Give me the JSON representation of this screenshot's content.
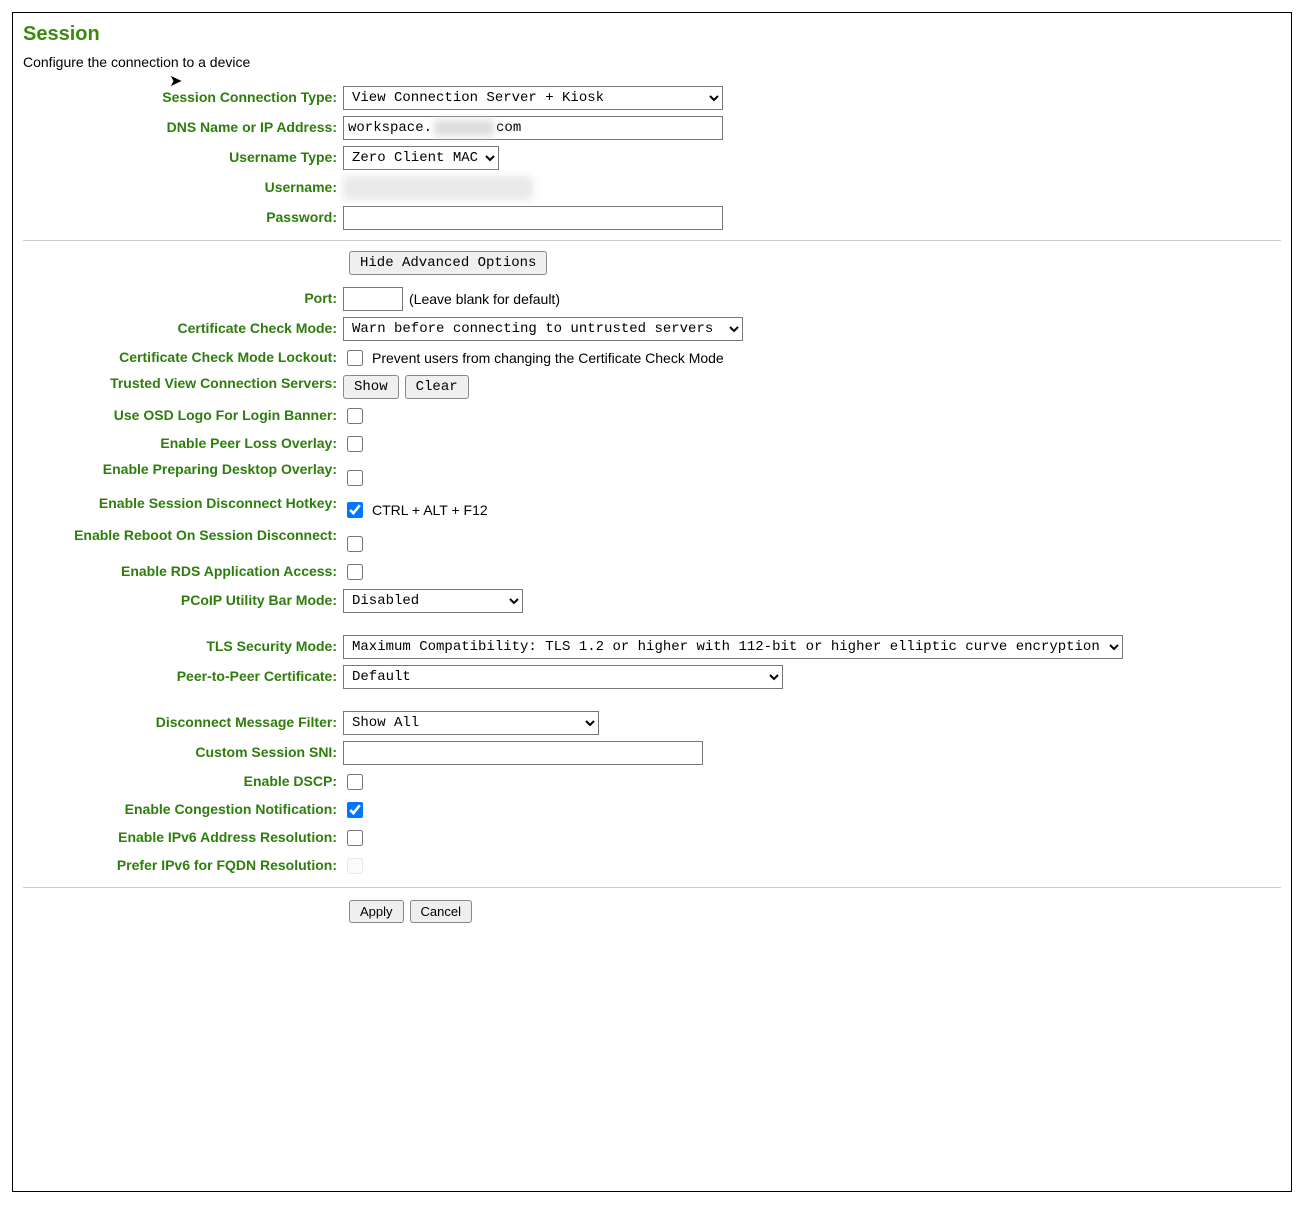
{
  "page": {
    "title": "Session",
    "subtitle": "Configure the connection to a device"
  },
  "labels": {
    "session_connection_type": "Session Connection Type:",
    "dns_name": "DNS Name or IP Address:",
    "username_type": "Username Type:",
    "username": "Username:",
    "password": "Password:",
    "port": "Port:",
    "port_hint": "(Leave blank for default)",
    "cert_check_mode": "Certificate Check Mode:",
    "cert_check_mode_lockout": "Certificate Check Mode Lockout:",
    "cert_lockout_text": "Prevent users from changing the Certificate Check Mode",
    "trusted_view_servers": "Trusted View Connection Servers:",
    "use_osd_logo": "Use OSD Logo For Login Banner:",
    "enable_peer_loss": "Enable Peer Loss Overlay:",
    "enable_prep_desktop": "Enable Preparing Desktop Overlay:",
    "enable_session_disc_hotkey": "Enable Session Disconnect Hotkey:",
    "hotkey_text": "CTRL + ALT + F12",
    "enable_reboot_disc": "Enable Reboot On Session Disconnect:",
    "enable_rds_app": "Enable RDS Application Access:",
    "pcoip_utility_bar": "PCoIP Utility Bar Mode:",
    "tls_security_mode": "TLS Security Mode:",
    "p2p_cert": "Peer-to-Peer Certificate:",
    "disc_msg_filter": "Disconnect Message Filter:",
    "custom_session_sni": "Custom Session SNI:",
    "enable_dscp": "Enable DSCP:",
    "enable_congestion": "Enable Congestion Notification:",
    "enable_ipv6_res": "Enable IPv6 Address Resolution:",
    "prefer_ipv6_fqdn": "Prefer IPv6 for FQDN Resolution:"
  },
  "buttons": {
    "hide_advanced": "Hide Advanced Options",
    "show": "Show",
    "clear": "Clear",
    "apply": "Apply",
    "cancel": "Cancel"
  },
  "values": {
    "session_connection_type": "View Connection Server + Kiosk",
    "dns_prefix": "workspace.",
    "dns_suffix": "com",
    "username_type": "Zero Client MAC",
    "password": "",
    "port": "",
    "cert_check_mode": "Warn before connecting to untrusted servers",
    "cert_lockout_checked": false,
    "use_osd_logo_checked": false,
    "enable_peer_loss_checked": false,
    "enable_prep_desktop_checked": false,
    "enable_session_disc_hotkey_checked": true,
    "enable_reboot_disc_checked": false,
    "enable_rds_app_checked": false,
    "pcoip_utility_bar": "Disabled",
    "tls_security_mode": "Maximum Compatibility: TLS 1.2 or higher with 112-bit or higher elliptic curve encryption",
    "p2p_cert": "Default",
    "disc_msg_filter": "Show All",
    "custom_session_sni": "",
    "enable_dscp_checked": false,
    "enable_congestion_checked": true,
    "enable_ipv6_res_checked": false,
    "prefer_ipv6_fqdn_checked": false,
    "prefer_ipv6_fqdn_disabled": true
  }
}
